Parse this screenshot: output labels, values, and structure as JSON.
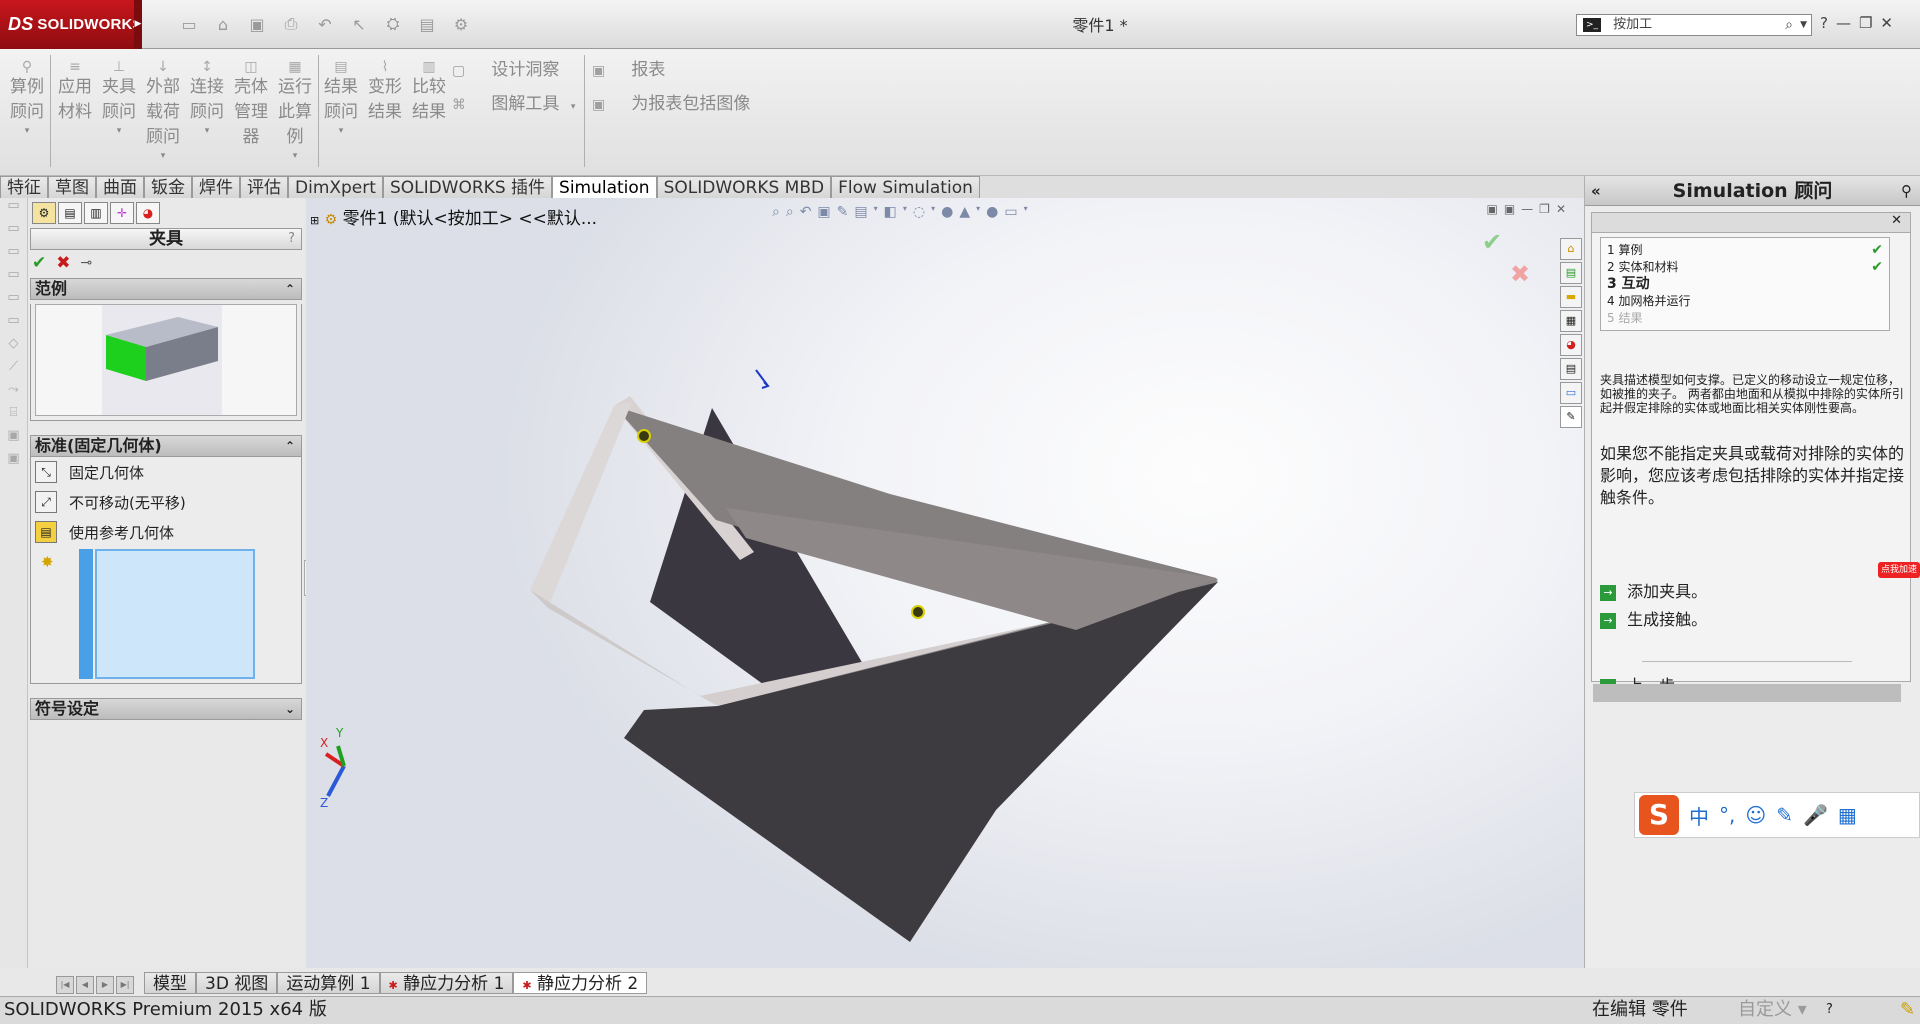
{
  "app": {
    "brand": "SOLIDWORKS",
    "brand_mark": "DS",
    "doc_title": "零件1 *",
    "search_value": "按加工",
    "window_controls": [
      "?",
      "—",
      "❐",
      "✕"
    ]
  },
  "command_manager": {
    "tools": [
      {
        "label": "算例\n顾问"
      },
      {
        "label": "应用\n材料"
      },
      {
        "label": "夹具\n顾问"
      },
      {
        "label": "外部\n载荷\n顾问"
      },
      {
        "label": "连接\n顾问"
      },
      {
        "label": "壳体\n管理\n器"
      },
      {
        "label": "运行\n此算\n例"
      },
      {
        "label": "结果\n顾问"
      },
      {
        "label": "变形\n结果"
      },
      {
        "label": "比较\n结果"
      }
    ],
    "design_insight": "设计洞察",
    "plot_tools": "图解工具",
    "report": "报表",
    "include_image": "为报表包括图像"
  },
  "tabs": [
    {
      "label": "特征"
    },
    {
      "label": "草图"
    },
    {
      "label": "曲面"
    },
    {
      "label": "钣金"
    },
    {
      "label": "焊件"
    },
    {
      "label": "评估"
    },
    {
      "label": "DimXpert"
    },
    {
      "label": "SOLIDWORKS 插件"
    },
    {
      "label": "Simulation"
    },
    {
      "label": "SOLIDWORKS MBD"
    },
    {
      "label": "Flow Simulation"
    }
  ],
  "property_manager": {
    "title": "夹具",
    "help": "?",
    "example_section": "范例",
    "standard_section": "标准(固定几何体)",
    "types": [
      {
        "label": "固定几何体"
      },
      {
        "label": "不可移动(无平移)"
      },
      {
        "label": "使用参考几何体"
      }
    ],
    "symbol_section": "符号设定"
  },
  "graphics": {
    "tree_node": "零件1  (默认<按加工> <<默认...",
    "triad_x": "X",
    "triad_y": "Y",
    "triad_z": "Z"
  },
  "advisor": {
    "title": "Simulation 顾问",
    "steps": [
      {
        "label": "1 算例",
        "done": true
      },
      {
        "label": "2 实体和材料",
        "done": true
      },
      {
        "label": "3 互动",
        "active": true
      },
      {
        "label": "4 加网格并运行"
      },
      {
        "label": "5 结果"
      }
    ],
    "small_text": "夹具描述模型如何支撑。已定义的移动设立一规定位移，如被推的夹子。 两者都由地面和从模拟中排除的实体所引起并假定排除的实体或地面比相关实体刚性要高。",
    "main_text": "如果您不能指定夹具或载荷对排除的实体的影响，您应该考虑包括排除的实体并指定接触条件。",
    "add_fixture": "添加夹具。",
    "gen_contact": "生成接触。",
    "prev_step": "上一步"
  },
  "ime": {
    "logo": "S",
    "lang": "中"
  },
  "badge": "点我加速",
  "bottom_tabs": [
    {
      "label": "模型"
    },
    {
      "label": "3D 视图"
    },
    {
      "label": "运动算例 1"
    },
    {
      "label": "静应力分析 1",
      "sim": true
    },
    {
      "label": "静应力分析 2",
      "sim": true,
      "active": true
    }
  ],
  "status": {
    "product": "SOLIDWORKS Premium 2015 x64 版",
    "editing": "在编辑 零件",
    "custom": "自定义",
    "custom_arrow": "▾",
    "help": "?"
  }
}
